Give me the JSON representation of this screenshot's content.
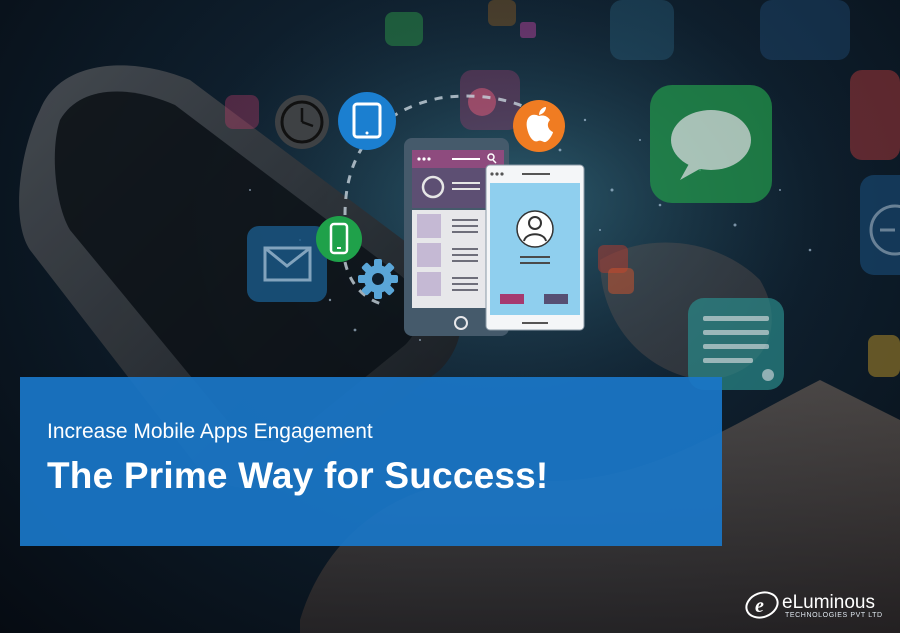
{
  "banner": {
    "subtitle": "Increase Mobile Apps Engagement",
    "headline": "The Prime Way for Success!"
  },
  "brand": {
    "name": "eLuminous",
    "tagline": "TECHNOLOGIES PVT LTD",
    "mark_letter": "e"
  },
  "colors": {
    "banner": "#1a76c7",
    "icon_blue": "#1b7fd0",
    "icon_green": "#1fa14a",
    "icon_orange": "#f07c22",
    "phone_header": "#8e4b7e",
    "screen_bg": "#8fcfee"
  },
  "icons": [
    "clock-icon",
    "tablet-icon",
    "apple-icon",
    "smartphone-icon",
    "gear-icon",
    "mail-icon",
    "chat-bubble-icon",
    "notes-icon",
    "user-profile-icon",
    "search-icon"
  ]
}
